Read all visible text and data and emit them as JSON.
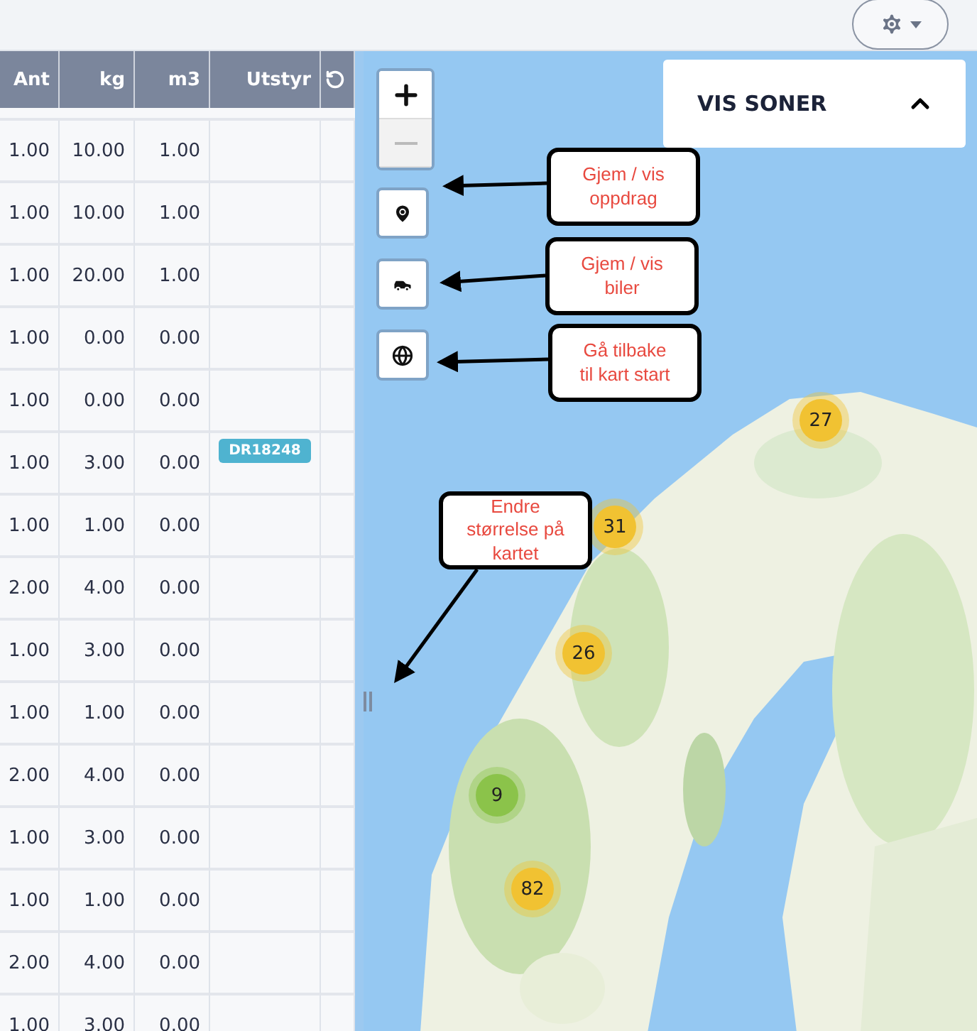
{
  "table": {
    "columns": [
      "Ant",
      "kg",
      "m3",
      "Utstyr"
    ],
    "rows": [
      {
        "ant": "1.00",
        "kg": "10.00",
        "m3": "1.00"
      },
      {
        "ant": "1.00",
        "kg": "10.00",
        "m3": "1.00"
      },
      {
        "ant": "1.00",
        "kg": "20.00",
        "m3": "1.00"
      },
      {
        "ant": "1.00",
        "kg": "0.00",
        "m3": "0.00"
      },
      {
        "ant": "1.00",
        "kg": "0.00",
        "m3": "0.00"
      },
      {
        "ant": "1.00",
        "kg": "3.00",
        "m3": "0.00",
        "utstyr": "DR18248"
      },
      {
        "ant": "1.00",
        "kg": "1.00",
        "m3": "0.00"
      },
      {
        "ant": "2.00",
        "kg": "4.00",
        "m3": "0.00"
      },
      {
        "ant": "1.00",
        "kg": "3.00",
        "m3": "0.00"
      },
      {
        "ant": "1.00",
        "kg": "1.00",
        "m3": "0.00"
      },
      {
        "ant": "2.00",
        "kg": "4.00",
        "m3": "0.00"
      },
      {
        "ant": "1.00",
        "kg": "3.00",
        "m3": "0.00"
      },
      {
        "ant": "1.00",
        "kg": "1.00",
        "m3": "0.00"
      },
      {
        "ant": "2.00",
        "kg": "4.00",
        "m3": "0.00"
      },
      {
        "ant": "1.00",
        "kg": "3.00",
        "m3": "0.00"
      }
    ]
  },
  "map": {
    "zoom_controls": [
      {
        "kind": "in",
        "disabled": false
      },
      {
        "kind": "out",
        "disabled": true
      }
    ],
    "layer_buttons": [
      {
        "kind": "pin"
      },
      {
        "kind": "car"
      },
      {
        "kind": "globe"
      }
    ],
    "zones_panel": {
      "title": "VIS SONER",
      "expanded": true
    },
    "clusters": [
      {
        "count": "27",
        "color": "#f1c232"
      },
      {
        "count": "31",
        "color": "#f1c232"
      },
      {
        "count": "26",
        "color": "#f1c232"
      },
      {
        "count": "9",
        "color": "#8bc34a"
      },
      {
        "count": "82",
        "color": "#f1c232"
      }
    ],
    "callouts": [
      {
        "text": "Gjem / vis oppdrag"
      },
      {
        "text": "Gjem / vis biler"
      },
      {
        "text": "Gå tilbake til kart start"
      },
      {
        "text": "Endre størrelse på kartet"
      }
    ]
  }
}
